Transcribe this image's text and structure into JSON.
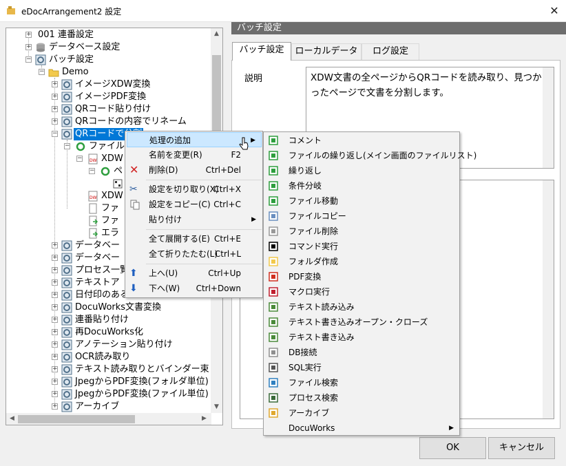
{
  "window": {
    "title": "eDocArrangement2 設定"
  },
  "tree": {
    "items": [
      {
        "label": "001 連番設定"
      },
      {
        "label": "データベース設定"
      },
      {
        "label": "バッチ設定"
      },
      {
        "label": "Demo"
      },
      {
        "label": "イメージXDW変換"
      },
      {
        "label": "イメージPDF変換"
      },
      {
        "label": "QRコード貼り付け"
      },
      {
        "label": "QRコードの内容でリネーム"
      },
      {
        "label": "QRコードで分割"
      },
      {
        "label": "ファイル"
      },
      {
        "label": "XDW"
      },
      {
        "label": "ペ"
      },
      {
        "label": "XDW"
      },
      {
        "label": "ファ"
      },
      {
        "label": "ファ"
      },
      {
        "label": "エラ"
      },
      {
        "label": "データベー"
      },
      {
        "label": "データベー"
      },
      {
        "label": "プロセス一覧"
      },
      {
        "label": "テキストア"
      },
      {
        "label": "日付印のある"
      },
      {
        "label": "DocuWorks文書変換"
      },
      {
        "label": "連番貼り付け"
      },
      {
        "label": "再DocuWorks化"
      },
      {
        "label": "アノテーション貼り付け"
      },
      {
        "label": "OCR読み取り"
      },
      {
        "label": "テキスト読み取りとバインダー束"
      },
      {
        "label": "JpegからPDF変換(フォルダ単位)"
      },
      {
        "label": "JpegからPDF変換(ファイル単位)"
      },
      {
        "label": "アーカイブ"
      }
    ]
  },
  "right": {
    "header": "バッチ設定",
    "tabs": [
      {
        "label": "バッチ設定"
      },
      {
        "label": "ローカルデータ"
      },
      {
        "label": "ログ設定"
      }
    ],
    "desc_label": "説明",
    "desc_text": "XDW文書の全ページからQRコードを読み取り、見つかったページで文書を分割します。"
  },
  "buttons": {
    "ok": "OK",
    "cancel": "キャンセル"
  },
  "context_menu": {
    "items": [
      {
        "label": "処理の追加",
        "shortcut": "",
        "arrow": "▶"
      },
      {
        "label": "名前を変更(R)",
        "shortcut": "F2"
      },
      {
        "label": "削除(D)",
        "shortcut": "Ctrl+Del"
      },
      {
        "label": "設定を切り取り(X)",
        "shortcut": "Ctrl+X"
      },
      {
        "label": "設定をコピー(C)",
        "shortcut": "Ctrl+C"
      },
      {
        "label": "貼り付け",
        "shortcut": "",
        "arrow": "▶"
      },
      {
        "label": "全て展開する(E)",
        "shortcut": "Ctrl+E"
      },
      {
        "label": "全て折りたたむ(L)",
        "shortcut": "Ctrl+L"
      },
      {
        "label": "上へ(U)",
        "shortcut": "Ctrl+Up"
      },
      {
        "label": "下へ(W)",
        "shortcut": "Ctrl+Down"
      }
    ]
  },
  "submenu": {
    "items": [
      {
        "label": "コメント",
        "icon": "comment-icon"
      },
      {
        "label": "ファイルの繰り返し(メイン画面のファイルリスト)",
        "icon": "file-loop-icon"
      },
      {
        "label": "繰り返し",
        "icon": "loop-icon"
      },
      {
        "label": "条件分岐",
        "icon": "branch-icon"
      },
      {
        "label": "ファイル移動",
        "icon": "file-move-icon"
      },
      {
        "label": "ファイルコピー",
        "icon": "file-copy-icon"
      },
      {
        "label": "ファイル削除",
        "icon": "file-delete-icon"
      },
      {
        "label": "コマンド実行",
        "icon": "command-icon"
      },
      {
        "label": "フォルダ作成",
        "icon": "folder-create-icon"
      },
      {
        "label": "PDF変換",
        "icon": "pdf-icon"
      },
      {
        "label": "マクロ実行",
        "icon": "macro-icon"
      },
      {
        "label": "テキスト読み込み",
        "icon": "text-read-icon"
      },
      {
        "label": "テキスト書き込みオープン・クローズ",
        "icon": "text-open-close-icon"
      },
      {
        "label": "テキスト書き込み",
        "icon": "text-write-icon"
      },
      {
        "label": "DB接続",
        "icon": "db-icon"
      },
      {
        "label": "SQL実行",
        "icon": "sql-icon"
      },
      {
        "label": "ファイル検索",
        "icon": "file-search-icon"
      },
      {
        "label": "プロセス検索",
        "icon": "process-search-icon"
      },
      {
        "label": "アーカイブ",
        "icon": "archive-icon"
      },
      {
        "label": "DocuWorks",
        "icon": "",
        "arrow": "▶"
      }
    ]
  },
  "colors": {
    "selection": "#0078d7",
    "menu_highlight": "#cce8ff",
    "header_bar": "#6d6d6d"
  }
}
